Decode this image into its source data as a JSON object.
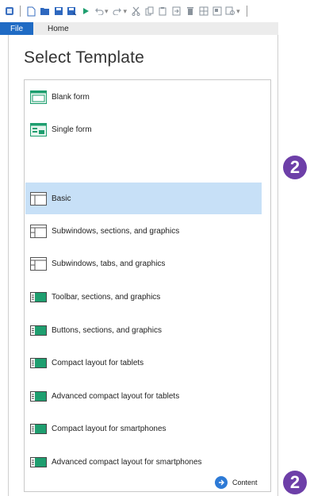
{
  "ribbon": {
    "file_tab": "File",
    "home_tab": "Home"
  },
  "panel": {
    "title": "Select Template"
  },
  "templates": [
    {
      "label": "Blank form",
      "icon": "blank-form-icon",
      "selected": false
    },
    {
      "label": "Single form",
      "icon": "single-form-icon",
      "selected": false
    },
    {
      "label": "Basic",
      "icon": "basic-layout-icon",
      "selected": true
    },
    {
      "label": "Subwindows, sections, and graphics",
      "icon": "subwindows-layout-icon",
      "selected": false
    },
    {
      "label": "Subwindows, tabs, and graphics",
      "icon": "subwindows-layout-icon",
      "selected": false
    },
    {
      "label": "Toolbar, sections, and graphics",
      "icon": "toolbar-layout-icon",
      "selected": false
    },
    {
      "label": "Buttons, sections, and graphics",
      "icon": "toolbar-layout-icon",
      "selected": false
    },
    {
      "label": "Compact layout for tablets",
      "icon": "toolbar-layout-icon",
      "selected": false
    },
    {
      "label": "Advanced compact layout for tablets",
      "icon": "toolbar-layout-icon",
      "selected": false
    },
    {
      "label": "Compact layout for smartphones",
      "icon": "toolbar-layout-icon",
      "selected": false
    },
    {
      "label": "Advanced compact layout for smartphones",
      "icon": "toolbar-layout-icon",
      "selected": false
    }
  ],
  "content_button": {
    "label": "Content"
  },
  "badges": {
    "first": "2",
    "second": "2"
  },
  "colors": {
    "accent": "#1f6bc4",
    "selection": "#c7e0f7",
    "badge": "#6d3fa8",
    "icon_green": "#1e9e6f"
  }
}
